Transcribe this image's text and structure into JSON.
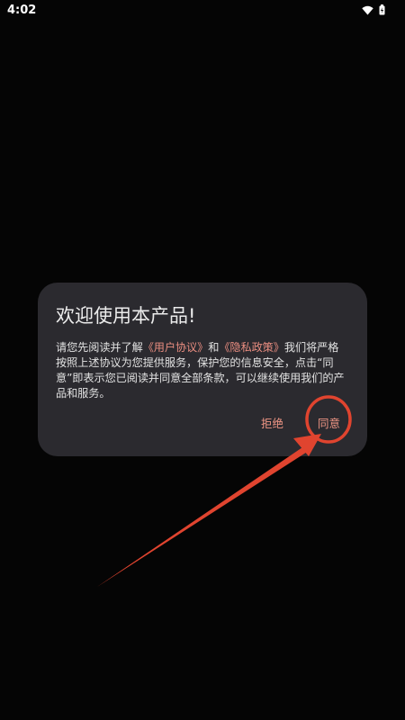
{
  "status_bar": {
    "time": "4:02",
    "icons": [
      "wifi-icon",
      "battery-icon"
    ]
  },
  "dialog": {
    "title": "欢迎使用本产品!",
    "message_parts": {
      "p1": "请您先阅读并了解",
      "user_agreement": "《用户协议》",
      "p2": "和",
      "privacy_policy": "《隐私政策》",
      "p3": "我们将严格按照上述协议为您提供服务，保护您的信息安全，点击“同意”即表示您已阅读并同意全部条款，可以继续使用我们的产品和服务。"
    },
    "buttons": {
      "reject": "拒绝",
      "agree": "同意"
    }
  },
  "colors": {
    "background": "#050505",
    "dialog_bg": "#2b2a2f",
    "link": "#e98d80",
    "annotation": "#e0442f"
  }
}
